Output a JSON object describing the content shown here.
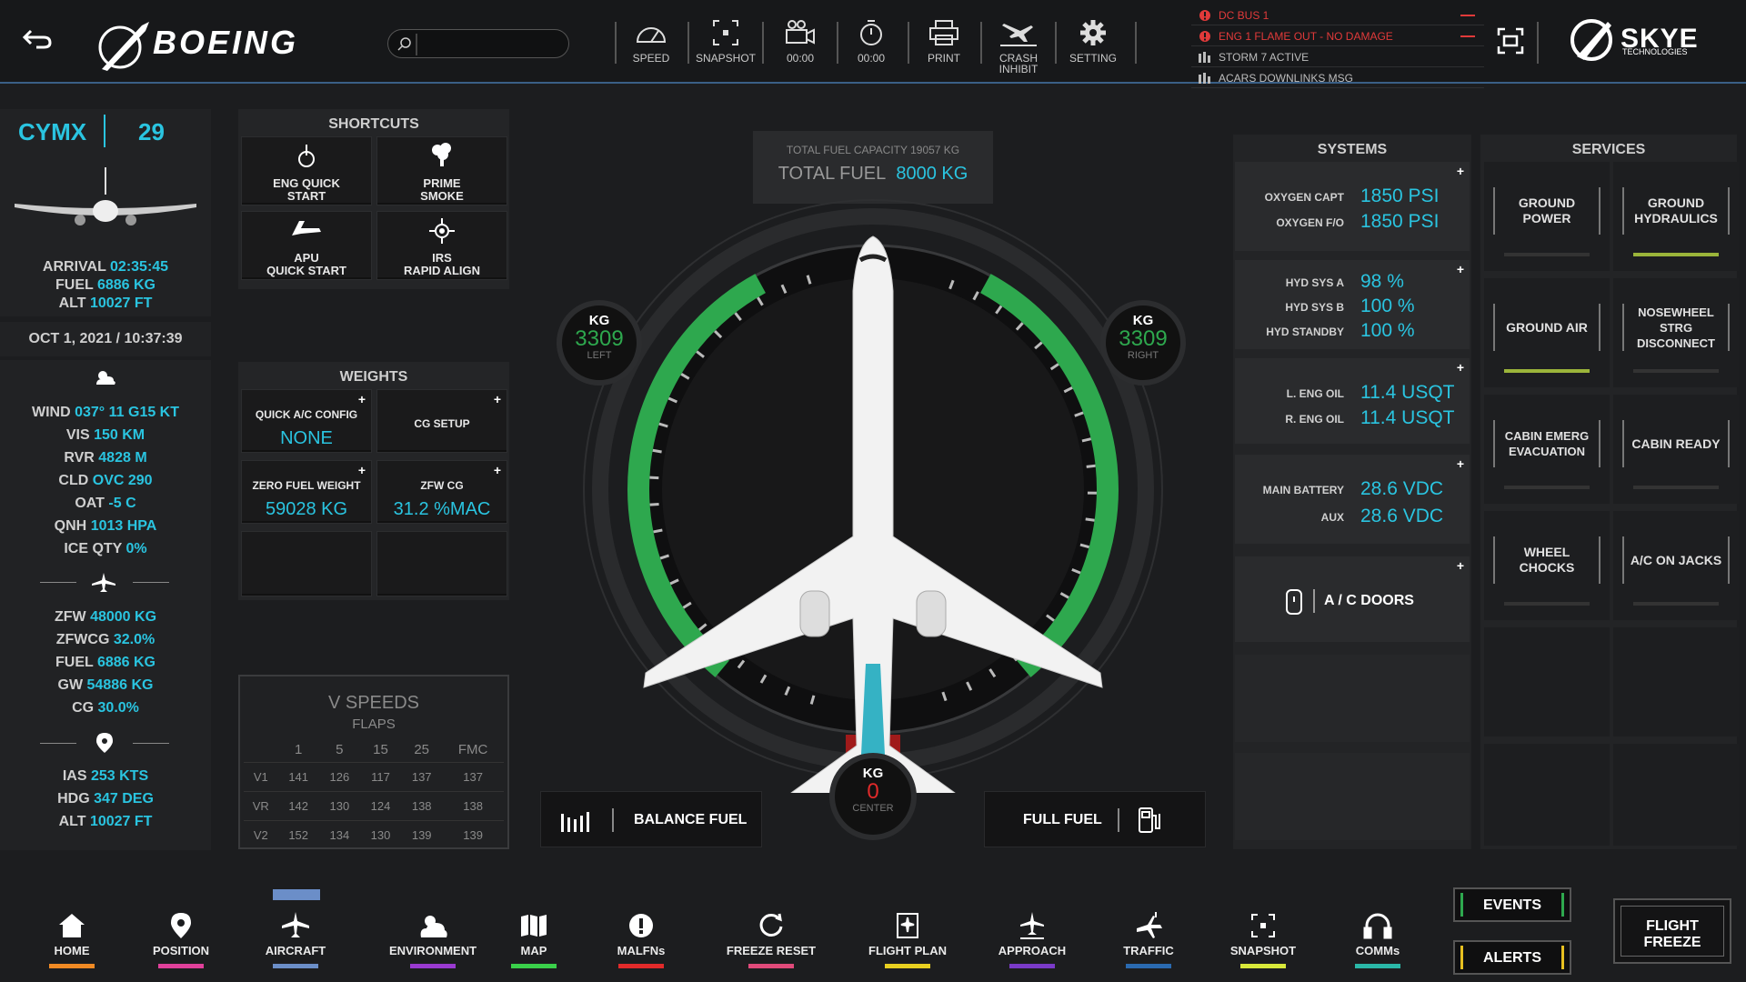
{
  "top": {
    "brand": "BOEING",
    "brand_mark": "®",
    "search_placeholder": "",
    "buttons": [
      {
        "label": "SPEED",
        "icon": "speedometer-icon"
      },
      {
        "label": "SNAPSHOT",
        "icon": "snapshot-icon"
      },
      {
        "label": "00:00",
        "icon": "video-camera-icon"
      },
      {
        "label": "00:00",
        "icon": "stopwatch-icon"
      },
      {
        "label": "PRINT",
        "icon": "printer-icon"
      },
      {
        "label": "CRASH INHIBIT",
        "icon": "crash-icon"
      },
      {
        "label": "SETTING",
        "icon": "gear-icon"
      }
    ],
    "alerts": [
      {
        "text": "DC BUS 1",
        "color": "#e13a3a"
      },
      {
        "text": "ENG 1 FLAME OUT - NO DAMAGE",
        "color": "#e13a3a"
      },
      {
        "text": "STORM 7 ACTIVE",
        "color": "#bdbdbd"
      },
      {
        "text": "ACARS DOWNLINKS MSG",
        "color": "#bdbdbd"
      }
    ],
    "skye": "SKYE",
    "skye_sub": "TECHNOLOGIES"
  },
  "left": {
    "airport": "CYMX",
    "runway": "29",
    "arrival_k": "ARRIVAL",
    "arrival": "02:35:45",
    "fuel_k": "FUEL",
    "fuel": "6886 KG",
    "alt_k": "ALT",
    "alt": "10027 FT",
    "datetime": "OCT 1, 2021 / 10:37:39",
    "wx": [
      {
        "k": "WIND",
        "v": "037° 11 G15  KT"
      },
      {
        "k": "VIS",
        "v": "150 KM"
      },
      {
        "k": "RVR",
        "v": "4828 M"
      },
      {
        "k": "CLD",
        "v": "OVC 290"
      },
      {
        "k": "OAT",
        "v": "-5 C"
      },
      {
        "k": "QNH",
        "v": "1013 HPA"
      },
      {
        "k": "ICE QTY",
        "v": "0%"
      }
    ],
    "wt": [
      {
        "k": "ZFW",
        "v": "48000 KG"
      },
      {
        "k": "ZFWCG",
        "v": "32.0%"
      },
      {
        "k": "FUEL",
        "v": "6886 KG"
      },
      {
        "k": "GW",
        "v": "54886 KG"
      },
      {
        "k": "CG",
        "v": "30.0%"
      }
    ],
    "pos": [
      {
        "k": "IAS",
        "v": "253 KTS"
      },
      {
        "k": "HDG",
        "v": "347 DEG"
      },
      {
        "k": "ALT",
        "v": "10027 FT"
      }
    ]
  },
  "shortcuts": {
    "title": "SHORTCUTS",
    "items": [
      [
        "ENG QUICK",
        "START"
      ],
      [
        "PRIME",
        "SMOKE"
      ],
      [
        "APU",
        "QUICK START"
      ],
      [
        "IRS",
        "RAPID ALIGN"
      ]
    ]
  },
  "weights": {
    "title": "WEIGHTS",
    "qac_k": "QUICK A/C CONFIG",
    "qac_v": "NONE",
    "cg": "CG SETUP",
    "zfw_k": "ZERO FUEL WEIGHT",
    "zfw_v": "59028 KG",
    "zfwcg_k": "ZFW CG",
    "zfwcg_v": "31.2 %MAC"
  },
  "vspeeds": {
    "title": "V SPEEDS",
    "sub": "FLAPS",
    "cols": [
      "",
      "1",
      "5",
      "15",
      "25",
      "FMC"
    ],
    "rows": [
      [
        "V1",
        "141",
        "126",
        "117",
        "137",
        "137"
      ],
      [
        "VR",
        "142",
        "130",
        "124",
        "138",
        "138"
      ],
      [
        "V2",
        "152",
        "134",
        "130",
        "139",
        "139"
      ]
    ]
  },
  "fuel": {
    "cap": "TOTAL FUEL CAPACITY 19057 KG",
    "total_k": "TOTAL FUEL",
    "total_v": "8000 KG",
    "unit": "KG",
    "left": "3309",
    "left_k": "LEFT",
    "right": "3309",
    "right_k": "RIGHT",
    "center": "0",
    "center_k": "CENTER",
    "left_frac": 0.44,
    "right_frac": 0.44,
    "balance": "BALANCE FUEL",
    "full": "FULL FUEL"
  },
  "systems": {
    "title": "SYSTEMS",
    "g1": [
      {
        "k": "OXYGEN CAPT",
        "v": "1850 PSI"
      },
      {
        "k": "OXYGEN F/O",
        "v": "1850 PSI"
      }
    ],
    "g2": [
      {
        "k": "HYD SYS A",
        "v": "98 %"
      },
      {
        "k": "HYD SYS B",
        "v": "100 %"
      },
      {
        "k": "HYD STANDBY",
        "v": "100 %"
      }
    ],
    "g3": [
      {
        "k": "L. ENG OIL",
        "v": "11.4 USQT"
      },
      {
        "k": "R. ENG OIL",
        "v": "11.4 USQT"
      }
    ],
    "g4": [
      {
        "k": "MAIN BATTERY",
        "v": "28.6 VDC"
      },
      {
        "k": "AUX",
        "v": "28.6 VDC"
      }
    ],
    "doors": "A / C  DOORS"
  },
  "services": {
    "title": "SERVICES",
    "items": [
      {
        "t": "GROUND POWER",
        "on": false
      },
      {
        "t": "GROUND HYDRAULICS",
        "on": true
      },
      {
        "t": "GROUND AIR",
        "on": true
      },
      {
        "t": "NOSEWHEEL STRG DISCONNECT",
        "on": false
      },
      {
        "t": "CABIN EMERG EVACUATION",
        "on": false
      },
      {
        "t": "CABIN READY",
        "on": false
      },
      {
        "t": "WHEEL CHOCKS",
        "on": false
      },
      {
        "t": "A/C ON JACKS",
        "on": false
      }
    ],
    "on_color": "#9bb53a"
  },
  "nav": [
    {
      "label": "HOME",
      "color": "#f08a24"
    },
    {
      "label": "POSITION",
      "color": "#e0409a"
    },
    {
      "label": "AIRCRAFT",
      "color": "#6b8ec8"
    },
    {
      "label": "ENVIRONMENT",
      "color": "#9a3ad0"
    },
    {
      "label": "MAP",
      "color": "#3ad04a"
    },
    {
      "label": "MALFNs",
      "color": "#e12a2a"
    },
    {
      "label": "FREEZE RESET",
      "color": "#e04a7a"
    },
    {
      "label": "FLIGHT PLAN",
      "color": "#e8d020"
    },
    {
      "label": "APPROACH",
      "color": "#7a3ac8"
    },
    {
      "label": "TRAFFIC",
      "color": "#2a6ab0"
    },
    {
      "label": "SNAPSHOT",
      "color": "#d8e83a"
    },
    {
      "label": "COMMs",
      "color": "#2ab8a8"
    }
  ],
  "events": "EVENTS",
  "alerts_btn": "ALERTS",
  "freeze": [
    "FLIGHT",
    "FREEZE"
  ]
}
